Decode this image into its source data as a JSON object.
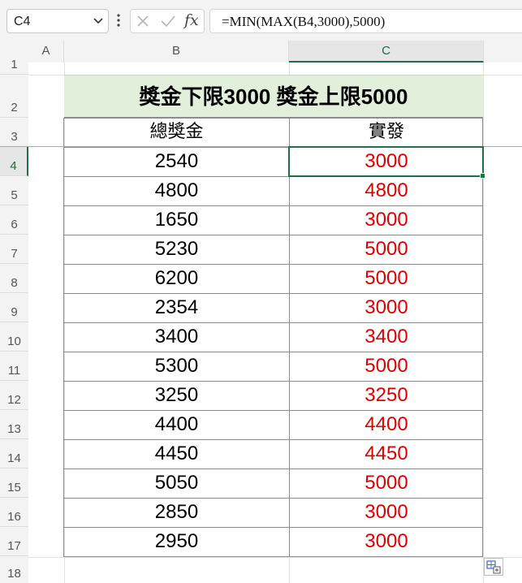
{
  "formula_bar": {
    "name_box": "C4",
    "fx_label": "fx",
    "formula": "=MIN(MAX(B4,3000),5000)"
  },
  "columns": [
    "A",
    "B",
    "C"
  ],
  "rows": [
    "1",
    "2",
    "3",
    "4",
    "5",
    "6",
    "7",
    "8",
    "9",
    "10",
    "11",
    "12",
    "13",
    "14",
    "15",
    "16",
    "17",
    "18"
  ],
  "sheet": {
    "title": "獎金下限3000 獎金上限5000",
    "header_b": "總獎金",
    "header_c": "實發",
    "data": [
      {
        "b": "2540",
        "c": "3000"
      },
      {
        "b": "4800",
        "c": "4800"
      },
      {
        "b": "1650",
        "c": "3000"
      },
      {
        "b": "5230",
        "c": "5000"
      },
      {
        "b": "6200",
        "c": "5000"
      },
      {
        "b": "2354",
        "c": "3000"
      },
      {
        "b": "3400",
        "c": "3400"
      },
      {
        "b": "5300",
        "c": "5000"
      },
      {
        "b": "3250",
        "c": "3250"
      },
      {
        "b": "4400",
        "c": "4400"
      },
      {
        "b": "4450",
        "c": "4450"
      },
      {
        "b": "5050",
        "c": "5000"
      },
      {
        "b": "2850",
        "c": "3000"
      },
      {
        "b": "2950",
        "c": "3000"
      }
    ]
  },
  "colors": {
    "accent_green": "#1e7145",
    "title_fill": "#e2efda",
    "result_red": "#e00000"
  },
  "icons": [
    "chevron-down-icon",
    "more-options-icon",
    "cancel-icon",
    "enter-icon",
    "function-icon",
    "quick-analysis-icon"
  ]
}
